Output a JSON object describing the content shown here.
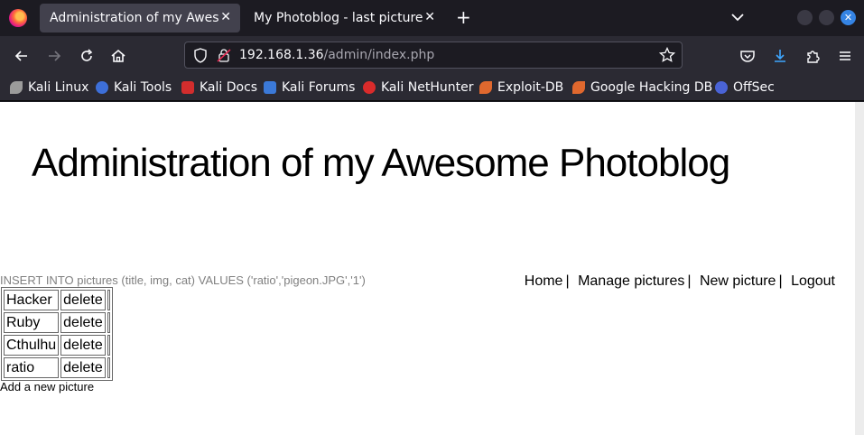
{
  "browser": {
    "tabs": [
      {
        "title": "Administration of my Awesome Photoblog",
        "active": true
      },
      {
        "title": "My Photoblog - last picture",
        "active": false
      }
    ],
    "new_tab": "+",
    "close_glyph": "✕",
    "url_host": "192.168.1.36",
    "url_path": "/admin/index.php",
    "bookmarks": [
      {
        "label": "Kali Linux",
        "icon": "kali-icon",
        "color": "#cccccc"
      },
      {
        "label": "Kali Tools",
        "icon": "kali-tools-icon",
        "color": "#3d6fd9"
      },
      {
        "label": "Kali Docs",
        "icon": "kali-docs-icon",
        "color": "#d32d2d"
      },
      {
        "label": "Kali Forums",
        "icon": "kali-forums-icon",
        "color": "#3b79d8"
      },
      {
        "label": "Kali NetHunter",
        "icon": "nethunter-icon",
        "color": "#d92b2b"
      },
      {
        "label": "Exploit-DB",
        "icon": "exploit-db-icon",
        "color": "#e0682e"
      },
      {
        "label": "Google Hacking DB",
        "icon": "ghdb-icon",
        "color": "#e0682e"
      },
      {
        "label": "OffSec",
        "icon": "offsec-icon",
        "color": "#4a63d6"
      }
    ]
  },
  "page": {
    "title": "Administration of my Awesome Photoblog",
    "sql_debug": "INSERT INTO pictures (title, img, cat) VALUES ('ratio','pigeon.JPG','1')",
    "nav": [
      {
        "label": "Home",
        "sep": "|"
      },
      {
        "label": "Manage pictures",
        "sep": "|"
      },
      {
        "label": "New picture",
        "sep": "|"
      },
      {
        "label": "Logout",
        "sep": ""
      }
    ],
    "pictures": [
      {
        "title": "Hacker",
        "action": "delete"
      },
      {
        "title": "Ruby",
        "action": "delete"
      },
      {
        "title": "Cthulhu",
        "action": "delete"
      },
      {
        "title": "ratio",
        "action": "delete"
      }
    ],
    "add_link": "Add a new picture"
  }
}
